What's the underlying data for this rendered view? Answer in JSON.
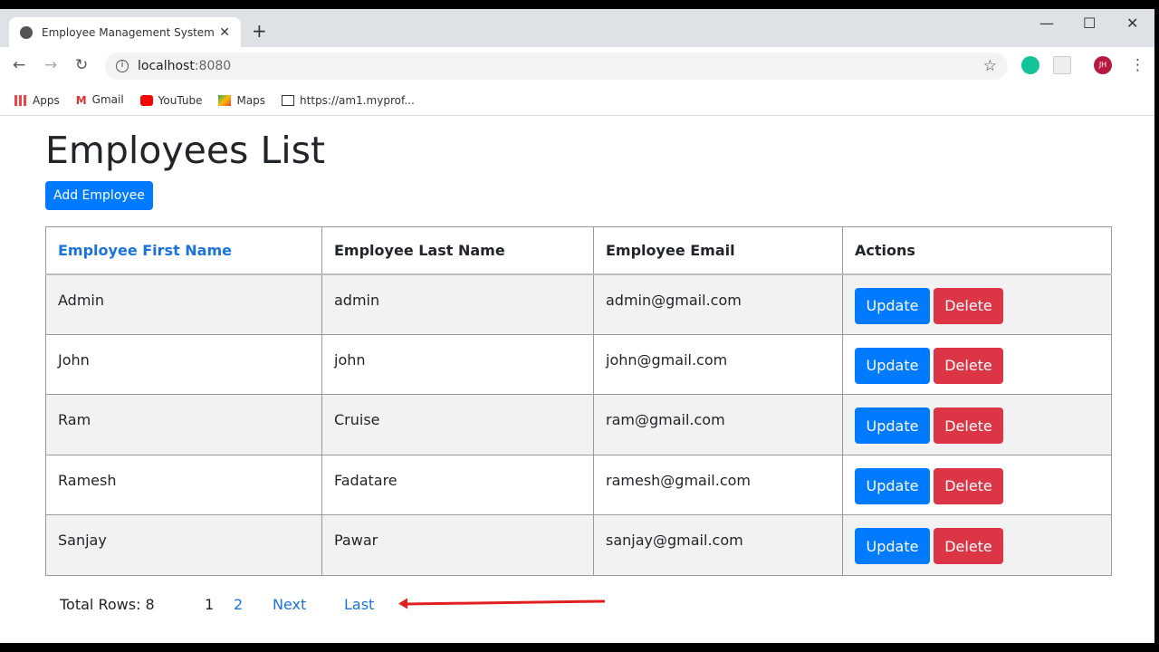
{
  "browser": {
    "tab_title": "Employee Management System",
    "url_host": "localhost",
    "url_port": ":8080",
    "bookmarks": [
      {
        "label": "Apps",
        "icon": "apps-grid-icon"
      },
      {
        "label": "Gmail",
        "icon": "gmail-icon"
      },
      {
        "label": "YouTube",
        "icon": "youtube-icon"
      },
      {
        "label": "Maps",
        "icon": "maps-icon"
      },
      {
        "label": "https://am1.myprof...",
        "icon": "mail-envelope-icon"
      }
    ],
    "avatar_initials": "JH"
  },
  "page": {
    "title": "Employees List",
    "add_button": "Add Employee"
  },
  "table": {
    "headers": [
      "Employee First Name",
      "Employee Last Name",
      "Employee Email",
      "Actions"
    ],
    "rows": [
      [
        "Admin",
        "admin",
        "admin@gmail.com"
      ],
      [
        "John",
        "john",
        "john@gmail.com"
      ],
      [
        "Ram",
        "Cruise",
        "ram@gmail.com"
      ],
      [
        "Ramesh",
        "Fadatare",
        "ramesh@gmail.com"
      ],
      [
        "Sanjay",
        "Pawar",
        "sanjay@gmail.com"
      ]
    ],
    "update_label": "Update",
    "delete_label": "Delete"
  },
  "pagination": {
    "total": "Total Rows: 8",
    "current": "1",
    "page2": "2",
    "next": "Next",
    "last": "Last"
  },
  "colors": {
    "primary": "#007bff",
    "danger": "#dc3545",
    "annotation_arrow": "#e02020"
  }
}
